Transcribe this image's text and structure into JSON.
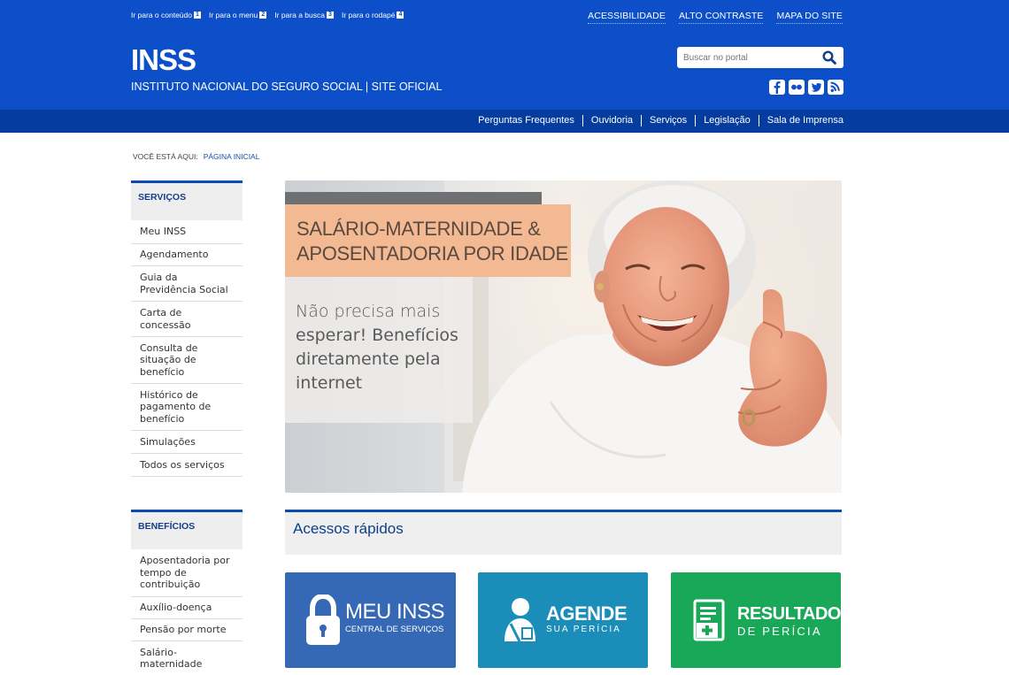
{
  "header": {
    "skip_links": [
      {
        "label": "Ir para o conteúdo",
        "key": "1"
      },
      {
        "label": "Ir para o menu",
        "key": "2"
      },
      {
        "label": "Ir para a busca",
        "key": "3"
      },
      {
        "label": "Ir para o rodapé",
        "key": "4"
      }
    ],
    "top_links": [
      "ACESSIBILIDADE",
      "ALTO CONTRASTE",
      "MAPA DO SITE"
    ],
    "logo": "INSS",
    "subtitle": "INSTITUTO NACIONAL DO SEGURO SOCIAL | SITE OFICIAL",
    "search_placeholder": "Buscar no portal",
    "social_icons": [
      "facebook-icon",
      "flickr-icon",
      "twitter-icon",
      "rss-icon"
    ]
  },
  "nav": {
    "items": [
      "Perguntas Frequentes",
      "Ouvidoria",
      "Serviços",
      "Legislação",
      "Sala de Imprensa"
    ]
  },
  "breadcrumb": {
    "label": "VOCÊ ESTÁ AQUI:",
    "current": "PÁGINA INICIAL"
  },
  "sidebar": {
    "services": {
      "title": "SERVIÇOS",
      "items": [
        "Meu INSS",
        "Agendamento",
        "Guia da Previdência Social",
        "Carta de concessão",
        "Consulta de situação de benefício",
        "Histórico de pagamento de benefício",
        "Simulações",
        "Todos os serviços"
      ]
    },
    "benefits": {
      "title": "BENEFÍCIOS",
      "items": [
        "Aposentadoria por tempo de contribuição",
        "Auxílio-doença",
        "Pensão por morte",
        "Salário-maternidade"
      ]
    }
  },
  "banner": {
    "headline_line1": "SALÁRIO-MATERNIDADE &",
    "headline_line2": "APOSENTADORIA POR IDADE",
    "body_line1": "Não precisa mais",
    "body_line2": "esperar! Benefícios",
    "body_line3": "diretamente pela",
    "body_line4": "internet"
  },
  "quick_access": {
    "title": "Acessos rápidos",
    "tiles": [
      {
        "big": "MEU INSS",
        "small": "CENTRAL DE SERVIÇOS",
        "icon": "lock-icon",
        "color": "#3569b5"
      },
      {
        "big": "AGENDE",
        "small": "SUA PERÍCIA",
        "icon": "person-icon",
        "color": "#1a8db8"
      },
      {
        "big": "RESULTADO",
        "small": "DE PERÍCIA",
        "icon": "medical-document-icon",
        "color": "#18a858"
      }
    ]
  },
  "colors": {
    "header_blue": "#0c4fc8",
    "nav_blue": "#053ca0",
    "accent_blue": "#0b4ab0"
  }
}
